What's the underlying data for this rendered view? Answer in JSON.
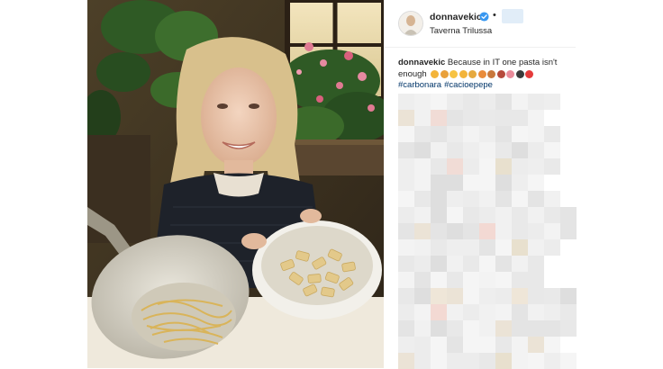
{
  "post": {
    "username": "donnavekic",
    "location": "Taverna Trilussa",
    "separator": "•",
    "caption": {
      "user": "donnavekic",
      "text": "Because in IT one pasta isn't enough",
      "emoji_colors": [
        "#f3b43a",
        "#e9a03a",
        "#f7c343",
        "#f3b43a",
        "#e6a93f",
        "#e98b3a",
        "#c9783c",
        "#b64a3b",
        "#e98b9a",
        "#3b3b3b",
        "#e53b3b"
      ],
      "hashtags": [
        "#carbonara",
        "#cacioepepe"
      ]
    },
    "colors": {
      "verified": "#3897f0",
      "hashtag": "#003569",
      "border": "#efefef"
    }
  }
}
